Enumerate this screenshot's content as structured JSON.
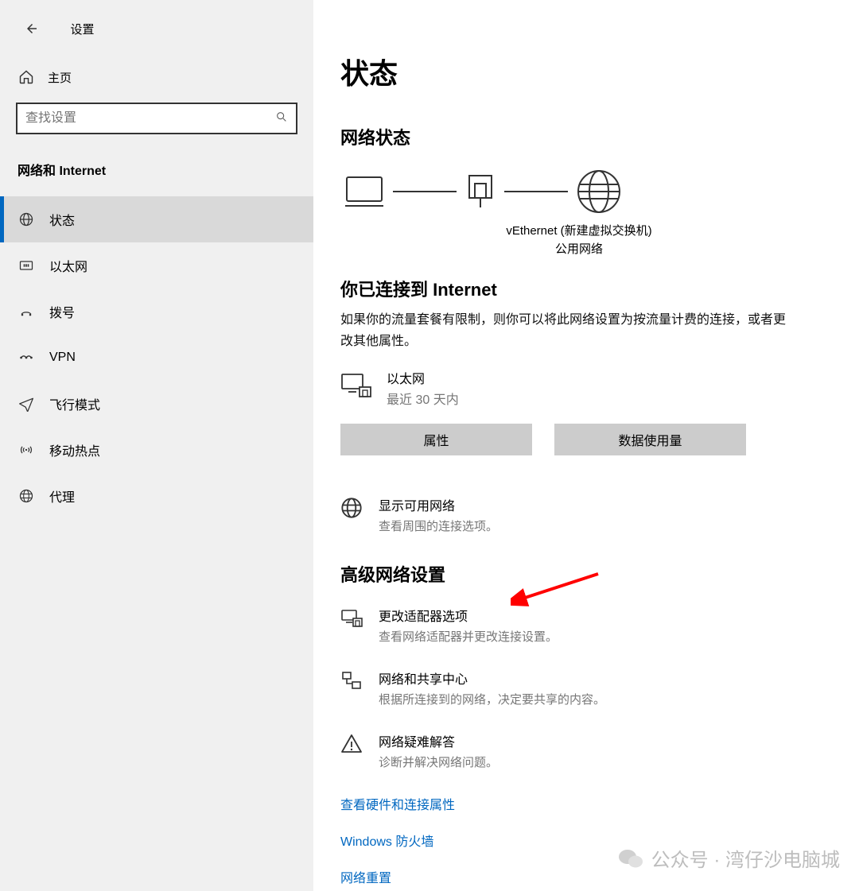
{
  "app": {
    "title": "设置"
  },
  "sidebar": {
    "home": "主页",
    "search_placeholder": "查找设置",
    "heading": "网络和 Internet",
    "items": [
      {
        "label": "状态",
        "active": true
      },
      {
        "label": "以太网",
        "active": false
      },
      {
        "label": "拨号",
        "active": false
      },
      {
        "label": "VPN",
        "active": false
      },
      {
        "label": "飞行模式",
        "active": false
      },
      {
        "label": "移动热点",
        "active": false
      },
      {
        "label": "代理",
        "active": false
      }
    ]
  },
  "main": {
    "page_title": "状态",
    "net_status_title": "网络状态",
    "diagram_adapter": "vEthernet (新建虚拟交换机)",
    "diagram_profile": "公用网络",
    "connected_title": "你已连接到 Internet",
    "connected_desc": "如果你的流量套餐有限制，则你可以将此网络设置为按流量计费的连接，或者更改其他属性。",
    "connection": {
      "name": "以太网",
      "sub": "最近 30 天内"
    },
    "btn_properties": "属性",
    "btn_usage": "数据使用量",
    "show_networks": {
      "title": "显示可用网络",
      "desc": "查看周围的连接选项。"
    },
    "adv_title": "高级网络设置",
    "adv_items": [
      {
        "title": "更改适配器选项",
        "desc": "查看网络适配器并更改连接设置。"
      },
      {
        "title": "网络和共享中心",
        "desc": "根据所连接到的网络，决定要共享的内容。"
      },
      {
        "title": "网络疑难解答",
        "desc": "诊断并解决网络问题。"
      }
    ],
    "links": [
      "查看硬件和连接属性",
      "Windows 防火墙",
      "网络重置"
    ]
  },
  "watermark": "公众号 · 湾仔沙电脑城"
}
